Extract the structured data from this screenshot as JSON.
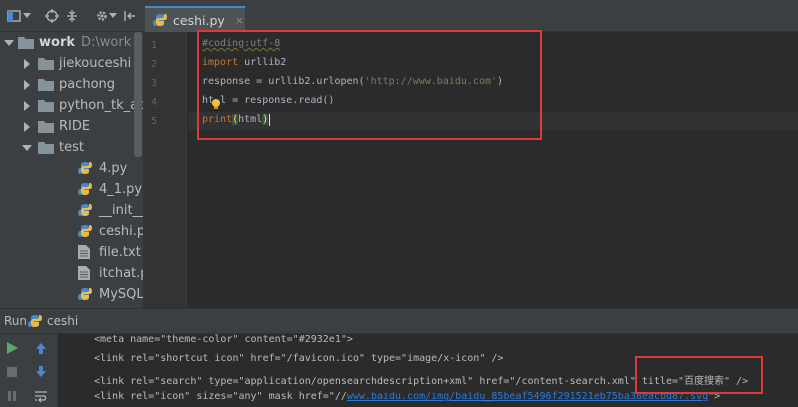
{
  "project_panel": {
    "root": {
      "label": "work",
      "path": "D:\\work"
    },
    "items": [
      {
        "label": "jiekouceshi",
        "type": "folder"
      },
      {
        "label": "pachong",
        "type": "folder"
      },
      {
        "label": "python_tk_adb",
        "type": "folder"
      },
      {
        "label": "RIDE",
        "type": "folder"
      },
      {
        "label": "test",
        "type": "folder-open"
      },
      {
        "label": "4.py",
        "type": "python"
      },
      {
        "label": "4_1.py",
        "type": "python"
      },
      {
        "label": "__init__.py",
        "type": "python"
      },
      {
        "label": "ceshi.py",
        "type": "python"
      },
      {
        "label": "file.txt",
        "type": "text"
      },
      {
        "label": "itchat.pkl",
        "type": "text"
      },
      {
        "label": "MySQL.py",
        "type": "python"
      }
    ]
  },
  "editor": {
    "tab_label": "ceshi.py",
    "tab_close": "×",
    "line_numbers": [
      "1",
      "2",
      "3",
      "4",
      "5"
    ],
    "code": {
      "line1": "#coding:utf-8",
      "line2_kw": "import",
      "line2_rest": " urllib2",
      "line3_pre": "response = urllib2.urlopen(",
      "line3_str": "'http://www.baidu.com'",
      "line3_post": ")",
      "line4_pre": "ht",
      "line4_post": "l = response.read()",
      "line5_kw": "print",
      "line5_open": "(",
      "line5_mid": "html",
      "line5_close": ")"
    }
  },
  "run_panel": {
    "title": "Run",
    "tab_label": "ceshi",
    "console": {
      "line1": "<meta name=\"theme-color\" content=\"#2932e1\">",
      "line2": "<link rel=\"shortcut icon\" href=\"/favicon.ico\" type=\"image/x-icon\" />",
      "line3": "<link rel=\"search\" type=\"application/opensearchdescription+xml\" href=\"/content-search.xml\" title=\"百度搜索\" />",
      "line4_pre": "<link rel=\"icon\" sizes=\"any\" mask href=\"//",
      "line4_link": "www.baidu.com/img/baidu_85beaf5496f291521eb75ba38eacbd87.svg",
      "line4_post": "\">"
    }
  },
  "colors": {
    "accent": "#4a88c7",
    "highlight_box": "#e0393a",
    "keyword": "#cc7832",
    "string": "#6a8759"
  }
}
